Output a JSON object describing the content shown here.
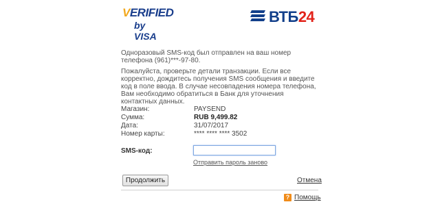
{
  "logos": {
    "visa_line1": "VERIFIED",
    "visa_line2": "by VISA",
    "bank_name": "ВТБ",
    "bank_number": "24"
  },
  "messages": {
    "sms_sent": "Одноразовый SMS-код был отправлен на ваш номер телефона (961)***-97-80.",
    "instructions": "Пожалуйста, проверьте детали транзакции. Если все корректно, дождитесь получения SMS сообщения и введите код в поле ввода. В случае несовпадения номера телефона, Вам необходимо обратиться в Банк для уточнения контактных данных."
  },
  "transaction": {
    "merchant_label": "Магазин:",
    "merchant_value": "PAYSEND",
    "amount_label": "Сумма:",
    "amount_value": "RUB 9,499.82",
    "date_label": "Дата:",
    "date_value": "31/07/2017",
    "card_label": "Номер карты:",
    "card_value": "**** **** **** 3502"
  },
  "sms": {
    "label": "SMS-код:",
    "value": "",
    "resend_link": "Отправить пароль заново"
  },
  "actions": {
    "continue_label": "Продолжить",
    "cancel_label": "Отмена",
    "help_label": "Помощь",
    "help_icon_glyph": "?"
  },
  "colors": {
    "visa_blue": "#1a3e8c",
    "visa_gold": "#f2a81d",
    "vtb_blue": "#123f8a",
    "vtb_red": "#e2231a",
    "help_orange": "#f08c1a"
  }
}
